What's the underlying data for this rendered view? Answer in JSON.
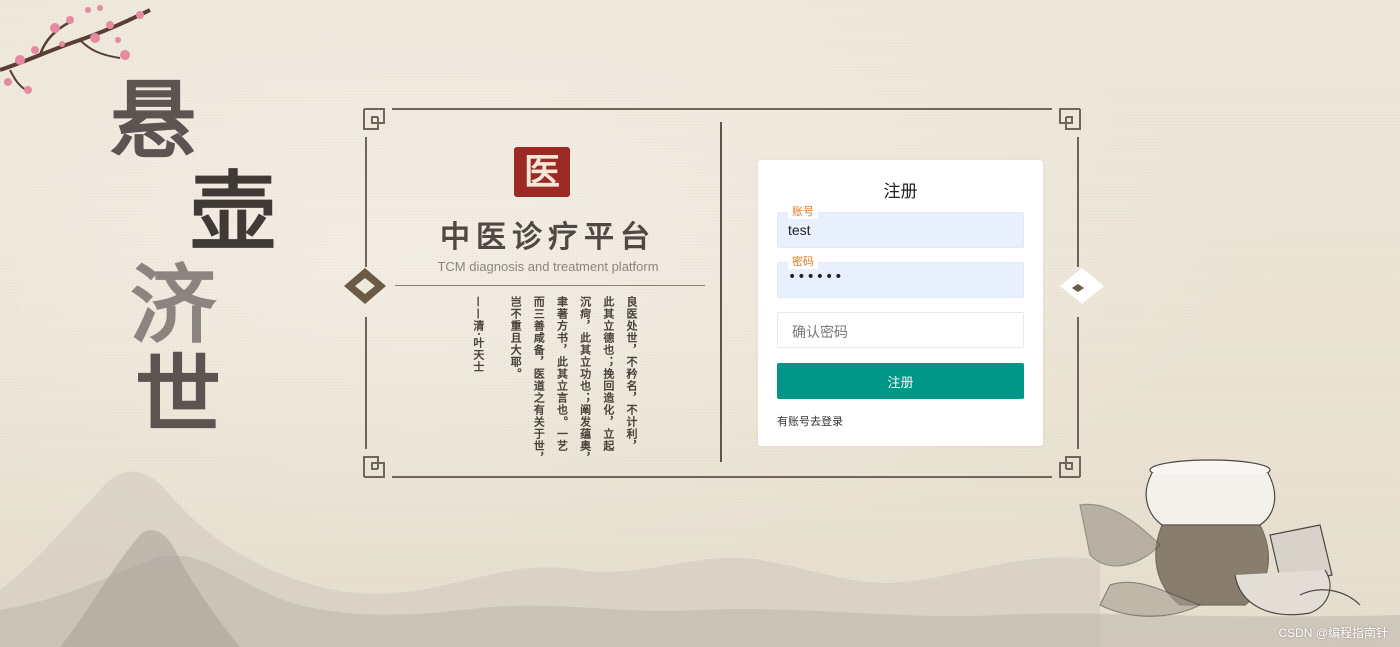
{
  "background": {
    "calligraphy": [
      "悬",
      "壶",
      "济",
      "世"
    ]
  },
  "logo": {
    "seal_char": "医",
    "title": "中医诊疗平台",
    "subtitle": "TCM diagnosis and treatment platform"
  },
  "poem": {
    "columns": [
      "良医处世，不矜名，不计利，",
      "此其立德也；挽回造化，立起",
      "沉疴，此其立功也；阐发蕴奥，",
      "聿著方书，此其立言也。一艺",
      "而三善咸备，医道之有关于世，",
      "岂不重且大耶。"
    ],
    "author": "——清·叶天士"
  },
  "form": {
    "title": "注册",
    "account": {
      "label": "账号",
      "value": "test"
    },
    "password": {
      "label": "密码",
      "value": "••••••"
    },
    "confirm": {
      "placeholder": "确认密码"
    },
    "submit_label": "注册",
    "login_link": "有账号去登录"
  },
  "colors": {
    "primary_button": "#009688",
    "legend_orange": "#e07a22",
    "seal_red": "#9b2a25",
    "autofill_blue": "#e8f0fe"
  },
  "watermark": "CSDN @编程指南针"
}
